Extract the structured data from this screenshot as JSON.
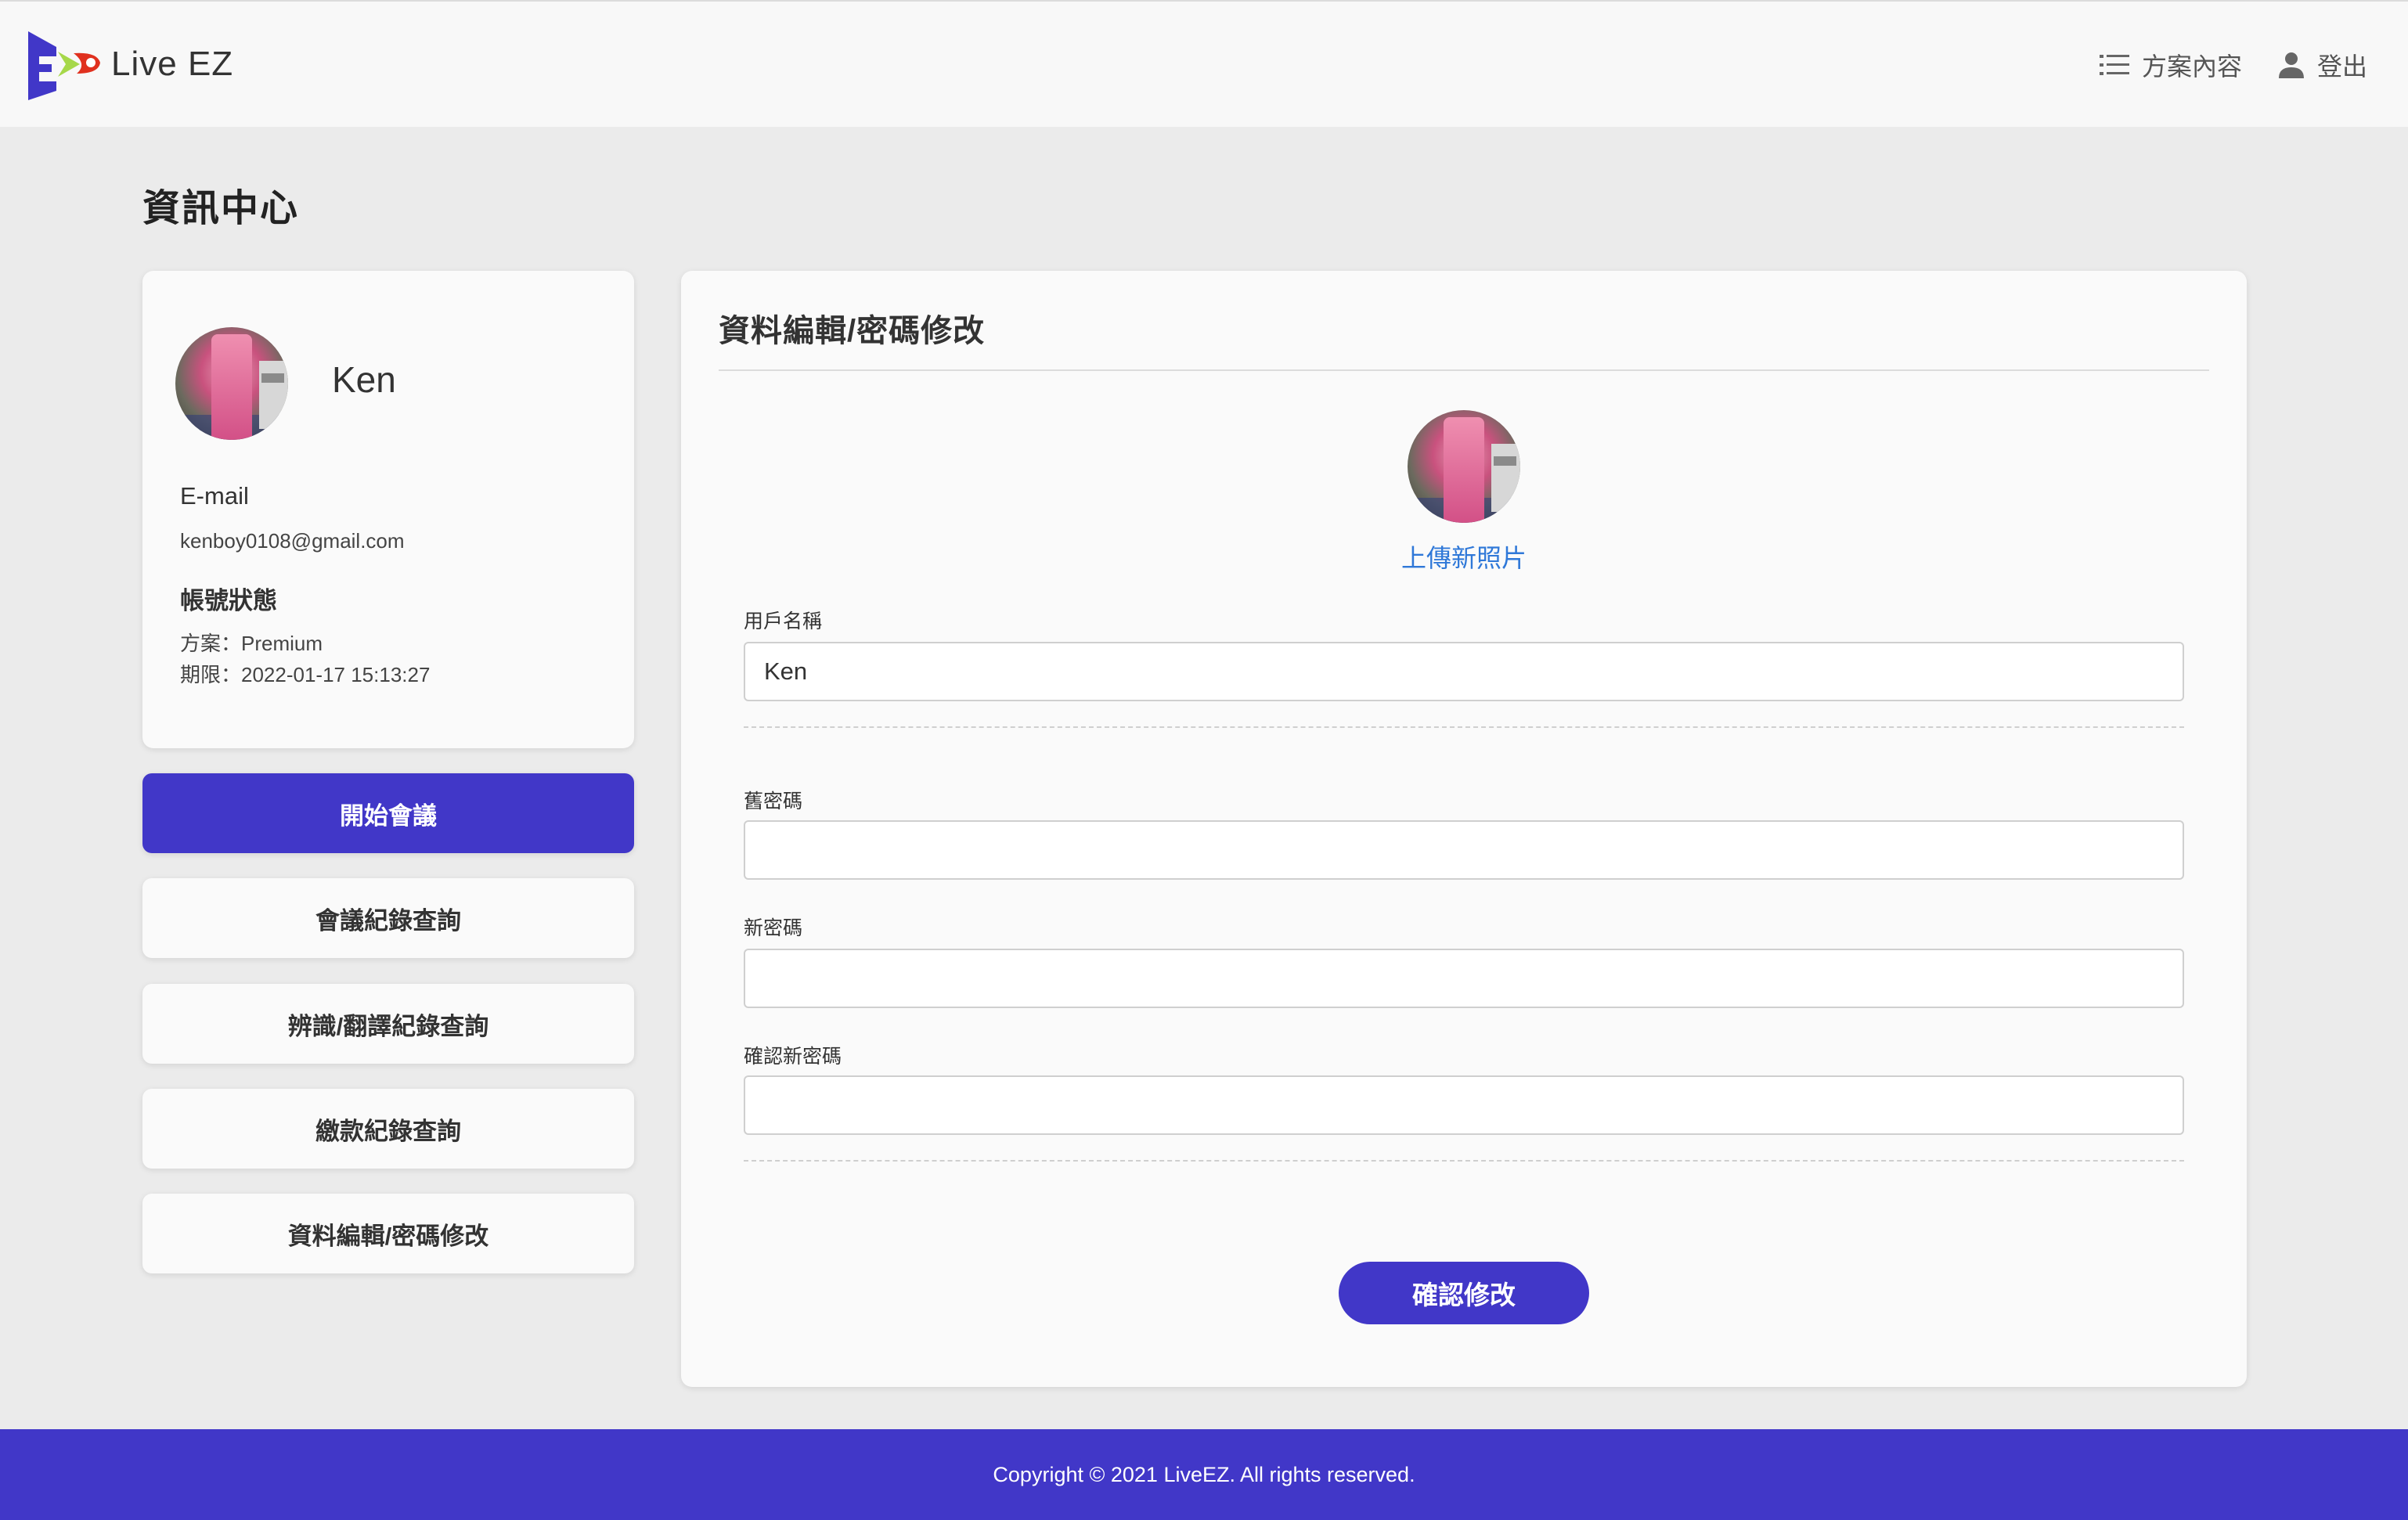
{
  "header": {
    "brand": "Live EZ",
    "nav": {
      "plan_label": "方案內容",
      "logout_label": "登出"
    }
  },
  "page_title": "資訊中心",
  "profile": {
    "name": "Ken",
    "email_label": "E-mail",
    "email": "kenboy0108@gmail.com",
    "status_label": "帳號狀態",
    "plan_line": "方案：Premium",
    "expire_line": "期限：2022-01-17 15:13:27"
  },
  "side_menu": {
    "start_meeting": "開始會議",
    "meeting_records": "會議紀錄查詢",
    "recognition_records": "辨識/翻譯紀錄查詢",
    "payment_records": "繳款紀錄查詢",
    "profile_edit": "資料編輯/密碼修改"
  },
  "panel": {
    "title": "資料編輯/密碼修改",
    "upload_label": "上傳新照片",
    "username_label": "用戶名稱",
    "username_value": "Ken",
    "old_password_label": "舊密碼",
    "new_password_label": "新密碼",
    "confirm_password_label": "確認新密碼",
    "submit_label": "確認修改"
  },
  "footer": {
    "copyright": "Copyright © 2021 LiveEZ. All rights reserved."
  },
  "colors": {
    "brand_primary": "#4137c8",
    "link": "#2f78d8",
    "logo_red": "#e0311f",
    "logo_green": "#a6d84a"
  }
}
